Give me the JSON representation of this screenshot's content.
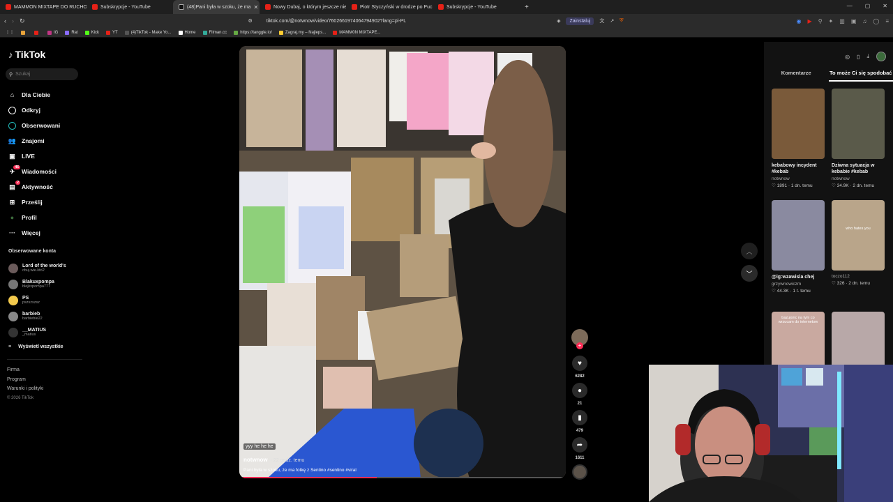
{
  "browser": {
    "tabs": [
      {
        "title": "MAMMON MIXTAPE DO RUCHO",
        "icon": "youtube-icon",
        "active": false
      },
      {
        "title": "Subskrypcje - YouTube",
        "icon": "youtube-icon",
        "active": false
      },
      {
        "title": "(48)Pani była w szoku, że ma",
        "icon": "tiktok-icon",
        "active": true
      },
      {
        "title": "Nowy Dubaj, o którym jeszcze nie sł",
        "icon": "youtube-icon",
        "active": false
      },
      {
        "title": "Piotr Styczyński w drodze po Pucha",
        "icon": "youtube-icon",
        "active": false
      },
      {
        "title": "Subskrypcje - YouTube",
        "icon": "youtube-icon",
        "active": false
      }
    ],
    "new_tab": "+",
    "url": "tiktok.com/@notwnow/video/7602661974064794902?lang=pl-PL",
    "install_label": "Zainstaluj",
    "bookmarks": [
      {
        "label": "",
        "color": "#e8a33a"
      },
      {
        "label": "",
        "color": "#e62117"
      },
      {
        "label": "IG",
        "color": "#c13584"
      },
      {
        "label": "Rat",
        "color": "#8a6cff"
      },
      {
        "label": "Kick",
        "color": "#53fc18"
      },
      {
        "label": "YT",
        "color": "#e62117"
      },
      {
        "label": "(4)TikTok - Make Yo...",
        "color": "#555"
      },
      {
        "label": "Home",
        "color": "#fff"
      },
      {
        "label": "Filman.cc",
        "color": "#3a9"
      },
      {
        "label": "https://tanggle.io/",
        "color": "#6a4"
      },
      {
        "label": "Zagraj.my – Najleps...",
        "color": "#fc3"
      },
      {
        "label": "MAMM0N MIXTAPE...",
        "color": "#e62117"
      }
    ]
  },
  "sidebar": {
    "logo": "TikTok",
    "search_placeholder": "Szukaj",
    "menu": [
      {
        "label": "Dla Ciebie",
        "icon": "home-icon",
        "glyph": "⌂"
      },
      {
        "label": "Odkryj",
        "icon": "compass-icon",
        "glyph": "◎"
      },
      {
        "label": "Obserwowani",
        "icon": "following-icon",
        "glyph": ""
      },
      {
        "label": "Znajomi",
        "icon": "friends-icon",
        "glyph": "👥"
      },
      {
        "label": "LIVE",
        "icon": "live-icon",
        "glyph": "▣"
      },
      {
        "label": "Wiadomości",
        "icon": "messages-icon",
        "glyph": "✈",
        "badge": "46"
      },
      {
        "label": "Aktywność",
        "icon": "activity-icon",
        "glyph": "▤",
        "badge": "2"
      },
      {
        "label": "Prześlij",
        "icon": "upload-icon",
        "glyph": "⊞"
      },
      {
        "label": "Profil",
        "icon": "profile-icon",
        "glyph": "●"
      },
      {
        "label": "Więcej",
        "icon": "more-icon",
        "glyph": "···"
      }
    ],
    "followed_title": "Obserwowane konta",
    "accounts": [
      {
        "name": "Lord of the world's",
        "handle": "cbuj.wie.kto2",
        "color": "#6b5b5b"
      },
      {
        "name": "Blakuxpompa",
        "handle": "blejkxpompa777",
        "color": "#777"
      },
      {
        "name": "PS",
        "handle": "pszszszsz",
        "color": "#f2c94c"
      },
      {
        "name": "barbieb",
        "handle": "barbiebie22",
        "color": "#888"
      },
      {
        "name": "__MATIUS",
        "handle": "_matius",
        "color": "#333"
      }
    ],
    "show_all": "Wyświetl wszystkie",
    "footer": [
      "Firma",
      "Program",
      "Warunki i polityki"
    ],
    "copyright": "© 2026 TikTok"
  },
  "video": {
    "caption_tag": "yyy he he he",
    "author": "notwnow",
    "time": "· 22 godz. temu",
    "description": "Pani była w szoku, że ma fotkę z Sentino #sentino #viral",
    "progress": 0.42
  },
  "actions": {
    "likes": "6282",
    "comments": "21",
    "saves": "479",
    "shares": "1611"
  },
  "right_panel": {
    "tabs": [
      "Komentarze",
      "To może Ci się spodobać"
    ],
    "active_tab": 1,
    "cards": [
      {
        "title": "kebabowy incydent #kebab",
        "author": "notwnow",
        "stats": "♡ 1891 · 1 dn. temu",
        "bg": "#7a5a3a",
        "overlay": ""
      },
      {
        "title": "Dziwna sytuacja w kebabie #kebab",
        "author": "notwnow",
        "stats": "♡ 34.9K · 2 dn. temu",
        "bg": "#5a5a4a",
        "overlay": ""
      },
      {
        "title": "@ig:wzawisla chej",
        "author": "grzywnowiczm",
        "stats": "♡ 44.3K · 1 t. temu",
        "bg": "#8a8aa0",
        "overlay": ""
      },
      {
        "title": "",
        "author": "toczo112",
        "stats": "♡ 326 · 2 dn. temu",
        "bg": "#b9a58a",
        "overlay": "who hates you"
      },
      {
        "title": "",
        "author": "",
        "stats": "",
        "bg": "#c9a9a0",
        "overlay": "bazujonc na tym co wrzucam do internetow"
      },
      {
        "title": "",
        "author": "",
        "stats": "",
        "bg": "#b8a8a8",
        "overlay": ""
      }
    ]
  },
  "colors": {
    "accent": "#fe2c55",
    "background": "#000000",
    "panel": "#121212"
  }
}
